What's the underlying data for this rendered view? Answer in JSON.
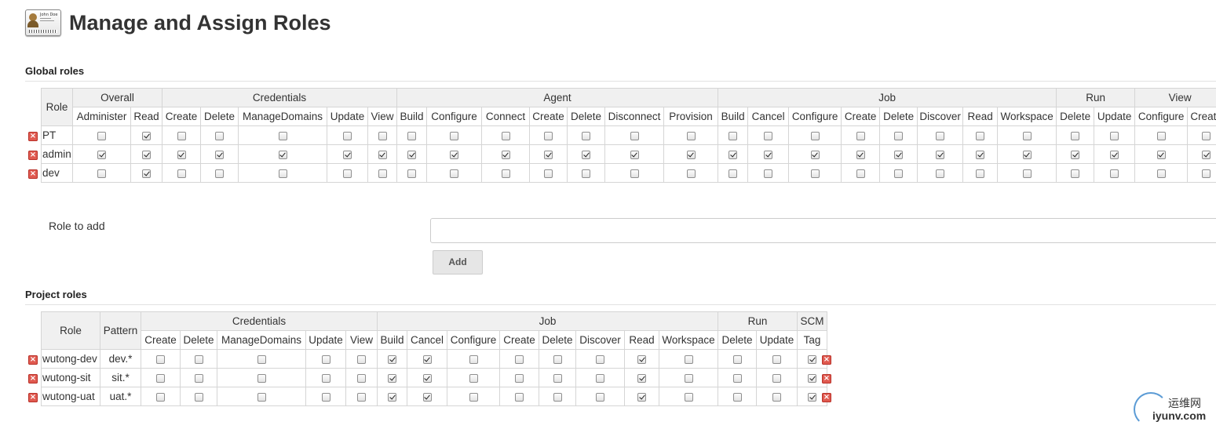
{
  "page": {
    "title": "Manage and Assign Roles"
  },
  "badge": {
    "name": "John Doe"
  },
  "global": {
    "section_title": "Global roles",
    "role_header": "Role",
    "groups": [
      {
        "label": "Overall",
        "perms": [
          "Administer",
          "Read"
        ]
      },
      {
        "label": "Credentials",
        "perms": [
          "Create",
          "Delete",
          "ManageDomains",
          "Update",
          "View"
        ]
      },
      {
        "label": "Agent",
        "perms": [
          "Build",
          "Configure",
          "Connect",
          "Create",
          "Delete",
          "Disconnect",
          "Provision"
        ]
      },
      {
        "label": "Job",
        "perms": [
          "Build",
          "Cancel",
          "Configure",
          "Create",
          "Delete",
          "Discover",
          "Read",
          "Workspace"
        ]
      },
      {
        "label": "Run",
        "perms": [
          "Delete",
          "Update"
        ]
      },
      {
        "label": "View",
        "perms": [
          "Configure",
          "Create"
        ]
      }
    ],
    "rows": [
      {
        "name": "PT",
        "checks": [
          0,
          1,
          0,
          0,
          0,
          0,
          0,
          0,
          0,
          0,
          0,
          0,
          0,
          0,
          0,
          0,
          0,
          0,
          0,
          0,
          0,
          0,
          0,
          0,
          0,
          0,
          0
        ]
      },
      {
        "name": "admin",
        "checks": [
          1,
          1,
          1,
          1,
          1,
          1,
          1,
          1,
          1,
          1,
          1,
          1,
          1,
          1,
          1,
          1,
          1,
          1,
          1,
          1,
          1,
          1,
          1,
          1,
          1,
          1,
          1
        ]
      },
      {
        "name": "dev",
        "checks": [
          0,
          1,
          0,
          0,
          0,
          0,
          0,
          0,
          0,
          0,
          0,
          0,
          0,
          0,
          0,
          0,
          0,
          0,
          0,
          0,
          0,
          0,
          0,
          0,
          0,
          0,
          0
        ]
      }
    ]
  },
  "add_role": {
    "label": "Role to add",
    "value": "",
    "button": "Add"
  },
  "project": {
    "section_title": "Project roles",
    "role_header": "Role",
    "pattern_header": "Pattern",
    "groups": [
      {
        "label": "Credentials",
        "perms": [
          "Create",
          "Delete",
          "ManageDomains",
          "Update",
          "View"
        ]
      },
      {
        "label": "Job",
        "perms": [
          "Build",
          "Cancel",
          "Configure",
          "Create",
          "Delete",
          "Discover",
          "Read",
          "Workspace"
        ]
      },
      {
        "label": "Run",
        "perms": [
          "Delete",
          "Update"
        ]
      },
      {
        "label": "SCM",
        "perms": [
          "Tag"
        ]
      }
    ],
    "rows": [
      {
        "name": "wutong-dev",
        "pattern": "dev.*",
        "checks": [
          0,
          0,
          0,
          0,
          0,
          1,
          1,
          0,
          0,
          0,
          0,
          1,
          0,
          0,
          0,
          1
        ]
      },
      {
        "name": "wutong-sit",
        "pattern": "sit.*",
        "checks": [
          0,
          0,
          0,
          0,
          0,
          1,
          1,
          0,
          0,
          0,
          0,
          1,
          0,
          0,
          0,
          1
        ]
      },
      {
        "name": "wutong-uat",
        "pattern": "uat.*",
        "checks": [
          0,
          0,
          0,
          0,
          0,
          1,
          1,
          0,
          0,
          0,
          0,
          1,
          0,
          0,
          0,
          1
        ]
      }
    ]
  },
  "icons": {
    "delete": "delete-x-icon",
    "checkbox": "checkbox-icon",
    "badge": "id-card-icon"
  },
  "colors": {
    "delete": "#e05a50",
    "header_bg": "#f0f0f0",
    "border": "#d5d5d5"
  },
  "watermark": {
    "cn": "运维网",
    "en": "iyunv.com"
  }
}
